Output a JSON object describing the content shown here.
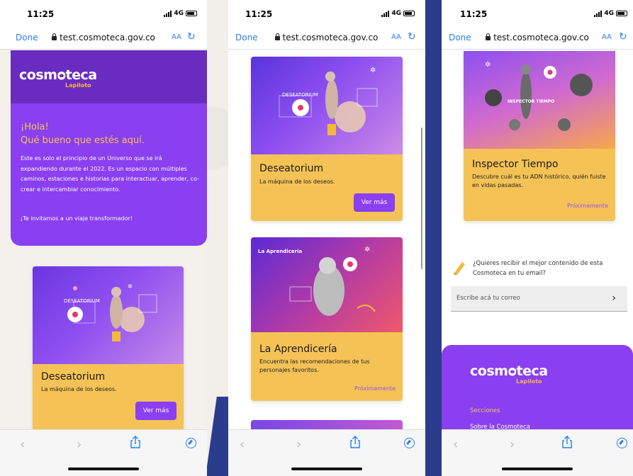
{
  "browser": {
    "time": "11:25",
    "network": "4G",
    "done_label": "Done",
    "url": "test.cosmoteca.gov.co",
    "text_size_label": "AA"
  },
  "brand": {
    "name_a": "cosm",
    "name_b": "teca",
    "sub": "Lapiloto"
  },
  "hero": {
    "hello": "¡Hola!",
    "welcome": "Qué bueno que estés aquí.",
    "body": "Este es solo el principio de un Universo que se irá expandiendo durante el 2022. Es un espacio con múltiples caminos, estaciones e historias para interactuar, aprender, co-crear e intercambiar conocimiento.",
    "invite": "¡Te invitamos a un viaje transformador!"
  },
  "cards": {
    "deseatorium": {
      "title": "Deseatorium",
      "desc": "La máquina de los deseos.",
      "button": "Ver más",
      "img_label": "DESEATORIUM"
    },
    "aprendiceria": {
      "title": "La Aprendicería",
      "desc": "Encuentra las recomendaciones de tus personajes favoritos.",
      "status": "Próximamente",
      "img_label": "La Aprendicería"
    },
    "inspector": {
      "title": "Inspector Tiempo",
      "desc": "Descubre cuál es tu ADN histórico, quién fuiste en vidas pasadas.",
      "status": "Próximamente",
      "img_label": "INSPECTOR TIEMPO"
    }
  },
  "newsletter": {
    "prompt": "¿Quieres recibir el mejor contenido de esta Cosmoteca en tu email?",
    "placeholder": "Escribe acá tu correo"
  },
  "footer": {
    "sections_heading": "Secciones",
    "about_link": "Sobre la Cosmoteca"
  },
  "colors": {
    "purple": "#8a3ff0",
    "yellow": "#f5c256",
    "ios_blue": "#2a7ff0"
  }
}
